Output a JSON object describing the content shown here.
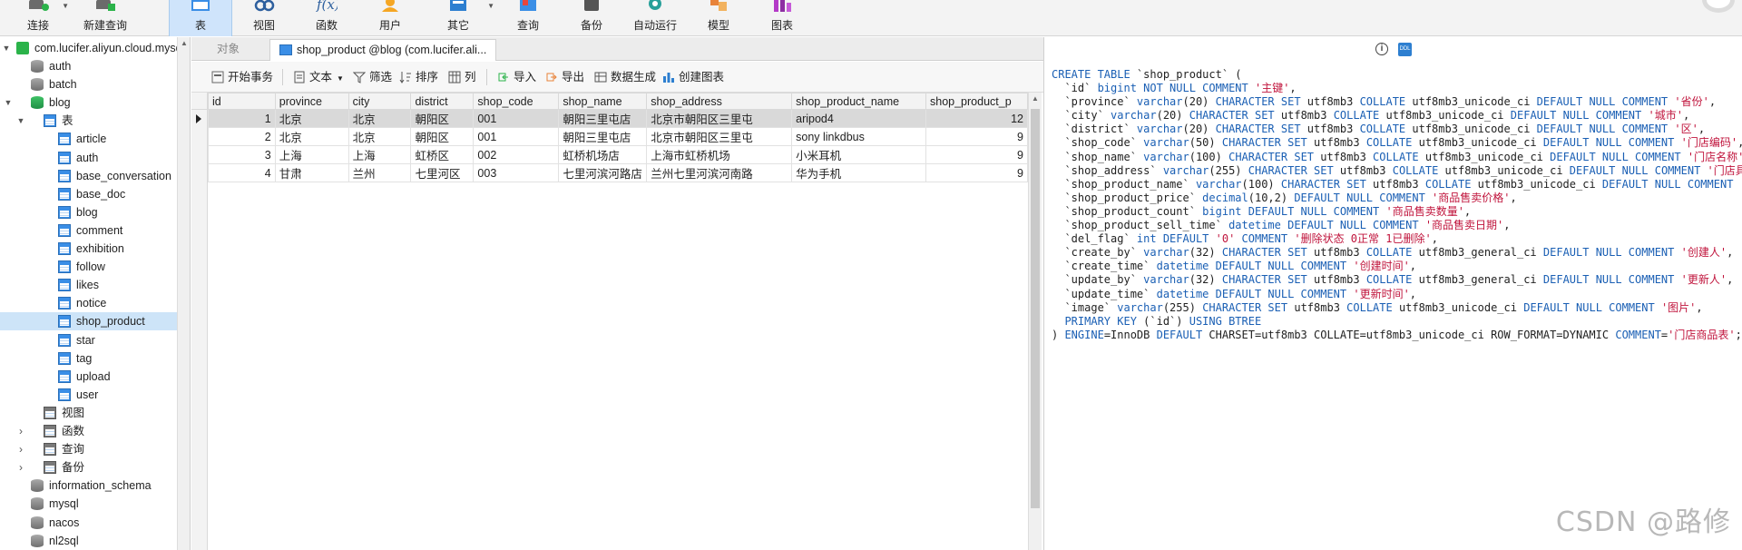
{
  "ribbon": {
    "buttons": [
      {
        "id": "connect",
        "label": "连接",
        "icon": "connect-icon",
        "caret": true
      },
      {
        "id": "new-query",
        "label": "新建查询",
        "icon": "new-query-icon"
      },
      {
        "id": "table",
        "label": "表",
        "icon": "table-icon",
        "active": true
      },
      {
        "id": "view",
        "label": "视图",
        "icon": "view-icon"
      },
      {
        "id": "function",
        "label": "函数",
        "icon": "function-icon"
      },
      {
        "id": "user",
        "label": "用户",
        "icon": "user-icon"
      },
      {
        "id": "other",
        "label": "其它",
        "icon": "other-icon",
        "caret": true
      },
      {
        "id": "query",
        "label": "查询",
        "icon": "query-icon"
      },
      {
        "id": "backup",
        "label": "备份",
        "icon": "backup-icon"
      },
      {
        "id": "auto-run",
        "label": "自动运行",
        "icon": "auto-run-icon"
      },
      {
        "id": "model",
        "label": "模型",
        "icon": "model-icon"
      },
      {
        "id": "chart",
        "label": "图表",
        "icon": "chart-icon"
      }
    ]
  },
  "tree": {
    "connection": "com.lucifer.aliyun.cloud.mysql",
    "items": [
      {
        "label": "auth",
        "kind": "db"
      },
      {
        "label": "batch",
        "kind": "db"
      },
      {
        "label": "blog",
        "kind": "db-open"
      },
      {
        "label": "表",
        "kind": "group"
      },
      {
        "label": "article",
        "kind": "table"
      },
      {
        "label": "auth",
        "kind": "table"
      },
      {
        "label": "base_conversation",
        "kind": "table"
      },
      {
        "label": "base_doc",
        "kind": "table"
      },
      {
        "label": "blog",
        "kind": "table"
      },
      {
        "label": "comment",
        "kind": "table"
      },
      {
        "label": "exhibition",
        "kind": "table"
      },
      {
        "label": "follow",
        "kind": "table"
      },
      {
        "label": "likes",
        "kind": "table"
      },
      {
        "label": "notice",
        "kind": "table"
      },
      {
        "label": "shop_product",
        "kind": "table",
        "selected": true
      },
      {
        "label": "star",
        "kind": "table"
      },
      {
        "label": "tag",
        "kind": "table"
      },
      {
        "label": "upload",
        "kind": "table"
      },
      {
        "label": "user",
        "kind": "table"
      },
      {
        "label": "视图",
        "kind": "group2"
      },
      {
        "label": "函数",
        "kind": "group2c"
      },
      {
        "label": "查询",
        "kind": "group2c"
      },
      {
        "label": "备份",
        "kind": "group2c"
      },
      {
        "label": "information_schema",
        "kind": "db"
      },
      {
        "label": "mysql",
        "kind": "db"
      },
      {
        "label": "nacos",
        "kind": "db"
      },
      {
        "label": "nl2sql",
        "kind": "db"
      }
    ]
  },
  "tabs": {
    "objects": "对象",
    "active": "shop_product @blog (com.lucifer.ali..."
  },
  "toolbar": {
    "begin_tx": "开始事务",
    "text": "文本",
    "filter": "筛选",
    "sort": "排序",
    "columns": "列",
    "import": "导入",
    "export": "导出",
    "datagen": "数据生成",
    "create_chart": "创建图表"
  },
  "table": {
    "columns": [
      "id",
      "province",
      "city",
      "district",
      "shop_code",
      "shop_name",
      "shop_address",
      "shop_product_name",
      "shop_product_p"
    ],
    "rows": [
      [
        "1",
        "北京",
        "北京",
        "朝阳区",
        "001",
        "朝阳三里屯店",
        "北京市朝阳区三里屯",
        "aripod4",
        "12"
      ],
      [
        "2",
        "北京",
        "北京",
        "朝阳区",
        "001",
        "朝阳三里屯店",
        "北京市朝阳区三里屯",
        "sony linkdbus",
        "9"
      ],
      [
        "3",
        "上海",
        "上海",
        "虹桥区",
        "002",
        "虹桥机场店",
        "上海市虹桥机场",
        "小米耳机",
        "9"
      ],
      [
        "4",
        "甘肃",
        "兰州",
        "七里河区",
        "003",
        "七里河滨河路店",
        "兰州七里河滨河南路",
        "华为手机",
        "9"
      ]
    ]
  },
  "ddl": {
    "lines": [
      [
        [
          "kw",
          "CREATE TABLE "
        ],
        [
          "",
          "`shop_product` ("
        ]
      ],
      [
        [
          "",
          "  `id` "
        ],
        [
          "kw",
          "bigint NOT NULL COMMENT "
        ],
        [
          "str",
          "'主键'"
        ],
        [
          "",
          ","
        ]
      ],
      [
        [
          "",
          "  `province` "
        ],
        [
          "kw",
          "varchar"
        ],
        [
          "",
          "(20) "
        ],
        [
          "kw",
          "CHARACTER SET "
        ],
        [
          "",
          "utf8mb3 "
        ],
        [
          "kw",
          "COLLATE "
        ],
        [
          "",
          "utf8mb3_unicode_ci "
        ],
        [
          "kw",
          "DEFAULT NULL COMMENT "
        ],
        [
          "str",
          "'省份'"
        ],
        [
          "",
          ","
        ]
      ],
      [
        [
          "",
          "  `city` "
        ],
        [
          "kw",
          "varchar"
        ],
        [
          "",
          "(20) "
        ],
        [
          "kw",
          "CHARACTER SET "
        ],
        [
          "",
          "utf8mb3 "
        ],
        [
          "kw",
          "COLLATE "
        ],
        [
          "",
          "utf8mb3_unicode_ci "
        ],
        [
          "kw",
          "DEFAULT NULL COMMENT "
        ],
        [
          "str",
          "'城市'"
        ],
        [
          "",
          ","
        ]
      ],
      [
        [
          "",
          "  `district` "
        ],
        [
          "kw",
          "varchar"
        ],
        [
          "",
          "(20) "
        ],
        [
          "kw",
          "CHARACTER SET "
        ],
        [
          "",
          "utf8mb3 "
        ],
        [
          "kw",
          "COLLATE "
        ],
        [
          "",
          "utf8mb3_unicode_ci "
        ],
        [
          "kw",
          "DEFAULT NULL COMMENT "
        ],
        [
          "str",
          "'区'"
        ],
        [
          "",
          ","
        ]
      ],
      [
        [
          "",
          "  `shop_code` "
        ],
        [
          "kw",
          "varchar"
        ],
        [
          "",
          "(50) "
        ],
        [
          "kw",
          "CHARACTER SET "
        ],
        [
          "",
          "utf8mb3 "
        ],
        [
          "kw",
          "COLLATE "
        ],
        [
          "",
          "utf8mb3_unicode_ci "
        ],
        [
          "kw",
          "DEFAULT NULL COMMENT "
        ],
        [
          "str",
          "'门店编码'"
        ],
        [
          "",
          ","
        ]
      ],
      [
        [
          "",
          "  `shop_name` "
        ],
        [
          "kw",
          "varchar"
        ],
        [
          "",
          "(100) "
        ],
        [
          "kw",
          "CHARACTER SET "
        ],
        [
          "",
          "utf8mb3 "
        ],
        [
          "kw",
          "COLLATE "
        ],
        [
          "",
          "utf8mb3_unicode_ci "
        ],
        [
          "kw",
          "DEFAULT NULL COMMENT "
        ],
        [
          "str",
          "'门店名称'"
        ],
        [
          "",
          ","
        ]
      ],
      [
        [
          "",
          "  `shop_address` "
        ],
        [
          "kw",
          "varchar"
        ],
        [
          "",
          "(255) "
        ],
        [
          "kw",
          "CHARACTER SET "
        ],
        [
          "",
          "utf8mb3 "
        ],
        [
          "kw",
          "COLLATE "
        ],
        [
          "",
          "utf8mb3_unicode_ci "
        ],
        [
          "kw",
          "DEFAULT NULL COMMENT "
        ],
        [
          "str",
          "'门店具体"
        ]
      ],
      [
        [
          "",
          "  `shop_product_name` "
        ],
        [
          "kw",
          "varchar"
        ],
        [
          "",
          "(100) "
        ],
        [
          "kw",
          "CHARACTER SET "
        ],
        [
          "",
          "utf8mb3 "
        ],
        [
          "kw",
          "COLLATE "
        ],
        [
          "",
          "utf8mb3_unicode_ci "
        ],
        [
          "kw",
          "DEFAULT NULL COMMENT "
        ],
        [
          "str",
          "'商品"
        ]
      ],
      [
        [
          "",
          "  `shop_product_price` "
        ],
        [
          "kw",
          "decimal"
        ],
        [
          "",
          "(10,2) "
        ],
        [
          "kw",
          "DEFAULT NULL COMMENT "
        ],
        [
          "str",
          "'商品售卖价格'"
        ],
        [
          "",
          ","
        ]
      ],
      [
        [
          "",
          "  `shop_product_count` "
        ],
        [
          "kw",
          "bigint DEFAULT NULL COMMENT "
        ],
        [
          "str",
          "'商品售卖数量'"
        ],
        [
          "",
          ","
        ]
      ],
      [
        [
          "",
          "  `shop_product_sell_time` "
        ],
        [
          "kw",
          "datetime DEFAULT NULL COMMENT "
        ],
        [
          "str",
          "'商品售卖日期'"
        ],
        [
          "",
          ","
        ]
      ],
      [
        [
          "",
          "  `del_flag` "
        ],
        [
          "kw",
          "int DEFAULT "
        ],
        [
          "str",
          "'0'"
        ],
        [
          "kw",
          " COMMENT "
        ],
        [
          "str",
          "'删除状态 0正常 1已删除'"
        ],
        [
          "",
          ","
        ]
      ],
      [
        [
          "",
          "  `create_by` "
        ],
        [
          "kw",
          "varchar"
        ],
        [
          "",
          "(32) "
        ],
        [
          "kw",
          "CHARACTER SET "
        ],
        [
          "",
          "utf8mb3 "
        ],
        [
          "kw",
          "COLLATE "
        ],
        [
          "",
          "utf8mb3_general_ci "
        ],
        [
          "kw",
          "DEFAULT NULL COMMENT "
        ],
        [
          "str",
          "'创建人'"
        ],
        [
          "",
          ","
        ]
      ],
      [
        [
          "",
          "  `create_time` "
        ],
        [
          "kw",
          "datetime DEFAULT NULL COMMENT "
        ],
        [
          "str",
          "'创建时间'"
        ],
        [
          "",
          ","
        ]
      ],
      [
        [
          "",
          "  `update_by` "
        ],
        [
          "kw",
          "varchar"
        ],
        [
          "",
          "(32) "
        ],
        [
          "kw",
          "CHARACTER SET "
        ],
        [
          "",
          "utf8mb3 "
        ],
        [
          "kw",
          "COLLATE "
        ],
        [
          "",
          "utf8mb3_general_ci "
        ],
        [
          "kw",
          "DEFAULT NULL COMMENT "
        ],
        [
          "str",
          "'更新人'"
        ],
        [
          "",
          ","
        ]
      ],
      [
        [
          "",
          "  `update_time` "
        ],
        [
          "kw",
          "datetime DEFAULT NULL COMMENT "
        ],
        [
          "str",
          "'更新时间'"
        ],
        [
          "",
          ","
        ]
      ],
      [
        [
          "",
          "  `image` "
        ],
        [
          "kw",
          "varchar"
        ],
        [
          "",
          "(255) "
        ],
        [
          "kw",
          "CHARACTER SET "
        ],
        [
          "",
          "utf8mb3 "
        ],
        [
          "kw",
          "COLLATE "
        ],
        [
          "",
          "utf8mb3_unicode_ci "
        ],
        [
          "kw",
          "DEFAULT NULL COMMENT "
        ],
        [
          "str",
          "'图片'"
        ],
        [
          "",
          ","
        ]
      ],
      [
        [
          "kw",
          "  PRIMARY KEY "
        ],
        [
          "",
          "(`id`) "
        ],
        [
          "kw",
          "USING BTREE"
        ]
      ],
      [
        [
          "",
          ") "
        ],
        [
          "kw",
          "ENGINE"
        ],
        [
          "",
          "=InnoDB "
        ],
        [
          "kw",
          "DEFAULT "
        ],
        [
          "",
          "CHARSET=utf8mb3 COLLATE=utf8mb3_unicode_ci ROW_FORMAT=DYNAMIC "
        ],
        [
          "kw",
          "COMMENT"
        ],
        [
          "",
          "="
        ],
        [
          "str",
          "'门店商品表'"
        ],
        [
          "",
          ";"
        ]
      ]
    ]
  },
  "watermark": "CSDN @路修",
  "colors": {
    "keyword": "#1a5fb4",
    "string": "#c0143c",
    "selection": "#cde4f8",
    "active_ribbon": "#cfe4fb"
  }
}
